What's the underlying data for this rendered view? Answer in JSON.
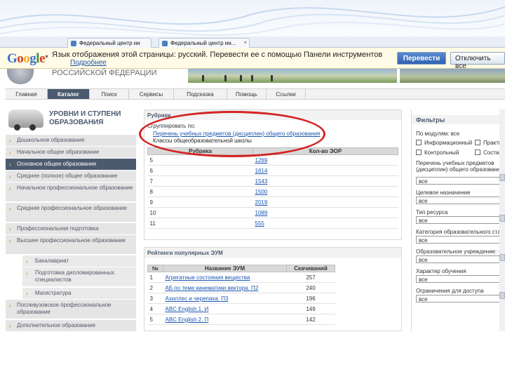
{
  "browser": {
    "tabs": [
      {
        "label": "Федеральный центр ин"
      },
      {
        "label": "Федеральный центр ин..."
      }
    ],
    "right_items": [
      ""
    ]
  },
  "translate_bar": {
    "logo": "Google",
    "message": "Язык отображения этой страницы: русский. Перевести ее с помощью Панели инструментов",
    "link": "Подробнее",
    "translate_button": "Перевести",
    "decline_button": "Отключить все"
  },
  "header": {
    "org": "РОССИЙСКОЙ ФЕДЕРАЦИИ"
  },
  "nav": {
    "items": [
      "Главная",
      "Каталог",
      "Поиск",
      "Сервисы",
      "Подсказка",
      "Помощь",
      "Ссылки"
    ],
    "active_index": 1
  },
  "sidebar": {
    "title": "УРОВНИ И СТУПЕНИ ОБРАЗОВАНИЯ",
    "items": [
      {
        "label": "Дошкольное образование"
      },
      {
        "label": "Начальное общее образование"
      },
      {
        "label": "Основное общее образование"
      },
      {
        "label": "Среднее (полное) общее образование"
      },
      {
        "label": "Начальное профессиональное образование"
      },
      {
        "label": "Среднее профессиональное образование"
      },
      {
        "label": "Профессиональная подготовка"
      },
      {
        "label": "Высшее профессиональное образование"
      },
      {
        "label": "Бакалавриат"
      },
      {
        "label": "Подготовка дипломированных специалистов"
      },
      {
        "label": "Магистратура"
      },
      {
        "label": "Послевузовское профессиональное образование"
      },
      {
        "label": "Дополнительное образование"
      }
    ]
  },
  "rubrics": {
    "title": "Рубрики",
    "group_by_label": "Сгруппировать по:",
    "group_link": "Перечень учебных предметов (дисциплин) общего образования",
    "group_selected": "Классы общеобразовательной школы",
    "columns": [
      "Рубрика",
      "Кол-во ЭОР"
    ],
    "rows": [
      {
        "rubric": "5",
        "count": "1269"
      },
      {
        "rubric": "6",
        "count": "1614"
      },
      {
        "rubric": "7",
        "count": "1543"
      },
      {
        "rubric": "8",
        "count": "1500"
      },
      {
        "rubric": "9",
        "count": "2019"
      },
      {
        "rubric": "10",
        "count": "1089"
      },
      {
        "rubric": "11",
        "count": "555"
      }
    ]
  },
  "ratings": {
    "title": "Рейтинги популярных ЭУМ",
    "columns": [
      "№",
      "Название ЭУМ",
      "Скачиваний"
    ],
    "rows": [
      {
        "n": "1",
        "name": "Агрегатные состояния вещества",
        "downloads": "257"
      },
      {
        "n": "2",
        "name": "АБ по теме кинематики вектора. П2",
        "downloads": "240"
      },
      {
        "n": "3",
        "name": "Ахиллес и черепаха. П3",
        "downloads": "196"
      },
      {
        "n": "4",
        "name": "ABC English 1. И",
        "downloads": "149"
      },
      {
        "n": "5",
        "name": "ABC English 2. П",
        "downloads": "142"
      }
    ]
  },
  "filters": {
    "title": "Фильтры",
    "modules_label": "По модулям: все",
    "check_labels": [
      "Информационный",
      "Практический",
      "Контрольный",
      "Составной"
    ],
    "fields": [
      {
        "label": "Перечень учебных предметов (дисциплин) общего образования",
        "value": "все"
      },
      {
        "label": "Целевое назначение",
        "value": "все"
      },
      {
        "label": "Тип ресурса",
        "value": "все"
      },
      {
        "label": "Категория образовательного стандарта",
        "value": "все"
      },
      {
        "label": "Образовательное учреждение: -",
        "value": "все"
      },
      {
        "label": "Характер обучения",
        "value": "все"
      },
      {
        "label": "Ограничения для доступа",
        "value": "все"
      }
    ]
  },
  "colors": {
    "accent": "#4b5a6e",
    "link": "#1a55b0",
    "highlight_ellipse": "#d42424"
  }
}
